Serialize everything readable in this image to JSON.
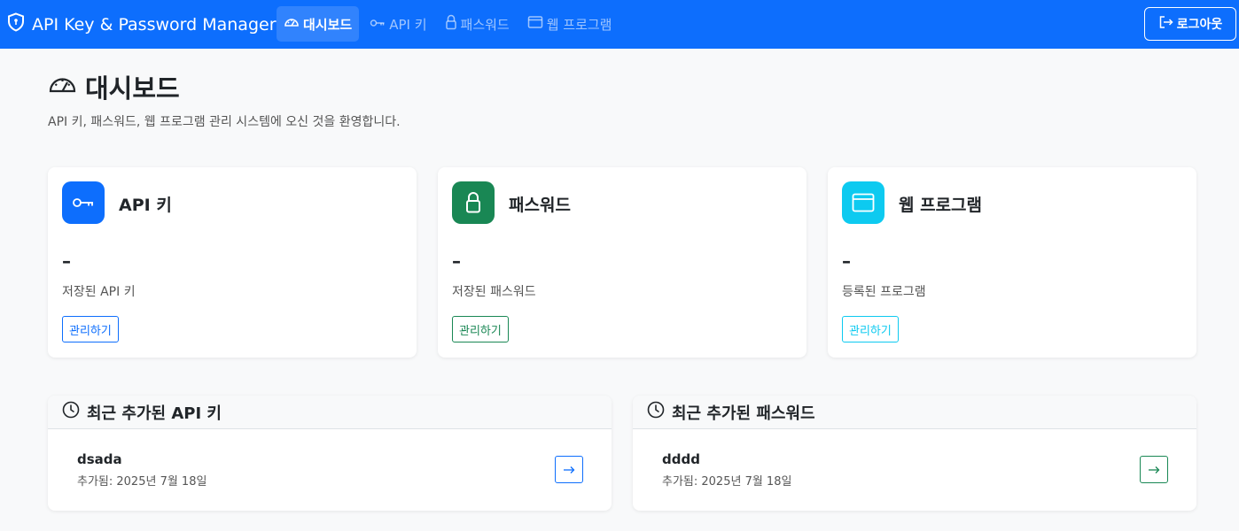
{
  "navbar": {
    "brand": "API Key & Password Manager",
    "items": [
      {
        "label": "대시보드",
        "icon": "speedometer-icon",
        "active": true
      },
      {
        "label": "API 키",
        "icon": "key-icon"
      },
      {
        "label": "패스워드",
        "icon": "lock-icon"
      },
      {
        "label": "웹 프로그램",
        "icon": "window-icon"
      }
    ],
    "logout_label": "로그아웃"
  },
  "header": {
    "title": "대시보드",
    "subtitle": "API 키, 패스워드, 웹 프로그램 관리 시스템에 오신 것을 환영합니다."
  },
  "cards": [
    {
      "title": "API 키",
      "value": "–",
      "description": "저장된 API 키",
      "button": "관리하기",
      "color": "#0d6efd",
      "icon": "key-icon"
    },
    {
      "title": "패스워드",
      "value": "–",
      "description": "저장된 패스워드",
      "button": "관리하기",
      "color": "#198754",
      "icon": "lock-icon"
    },
    {
      "title": "웹 프로그램",
      "value": "–",
      "description": "등록된 프로그램",
      "button": "관리하기",
      "color": "#0dcaf0",
      "icon": "window-icon"
    }
  ],
  "recent": [
    {
      "title": "최근 추가된 API 키",
      "item_name": "dsada",
      "item_date": "추가됨: 2025년 7월 18일",
      "color": "#0d6efd"
    },
    {
      "title": "최근 추가된 패스워드",
      "item_name": "dddd",
      "item_date": "추가됨: 2025년 7월 18일",
      "color": "#198754"
    }
  ]
}
